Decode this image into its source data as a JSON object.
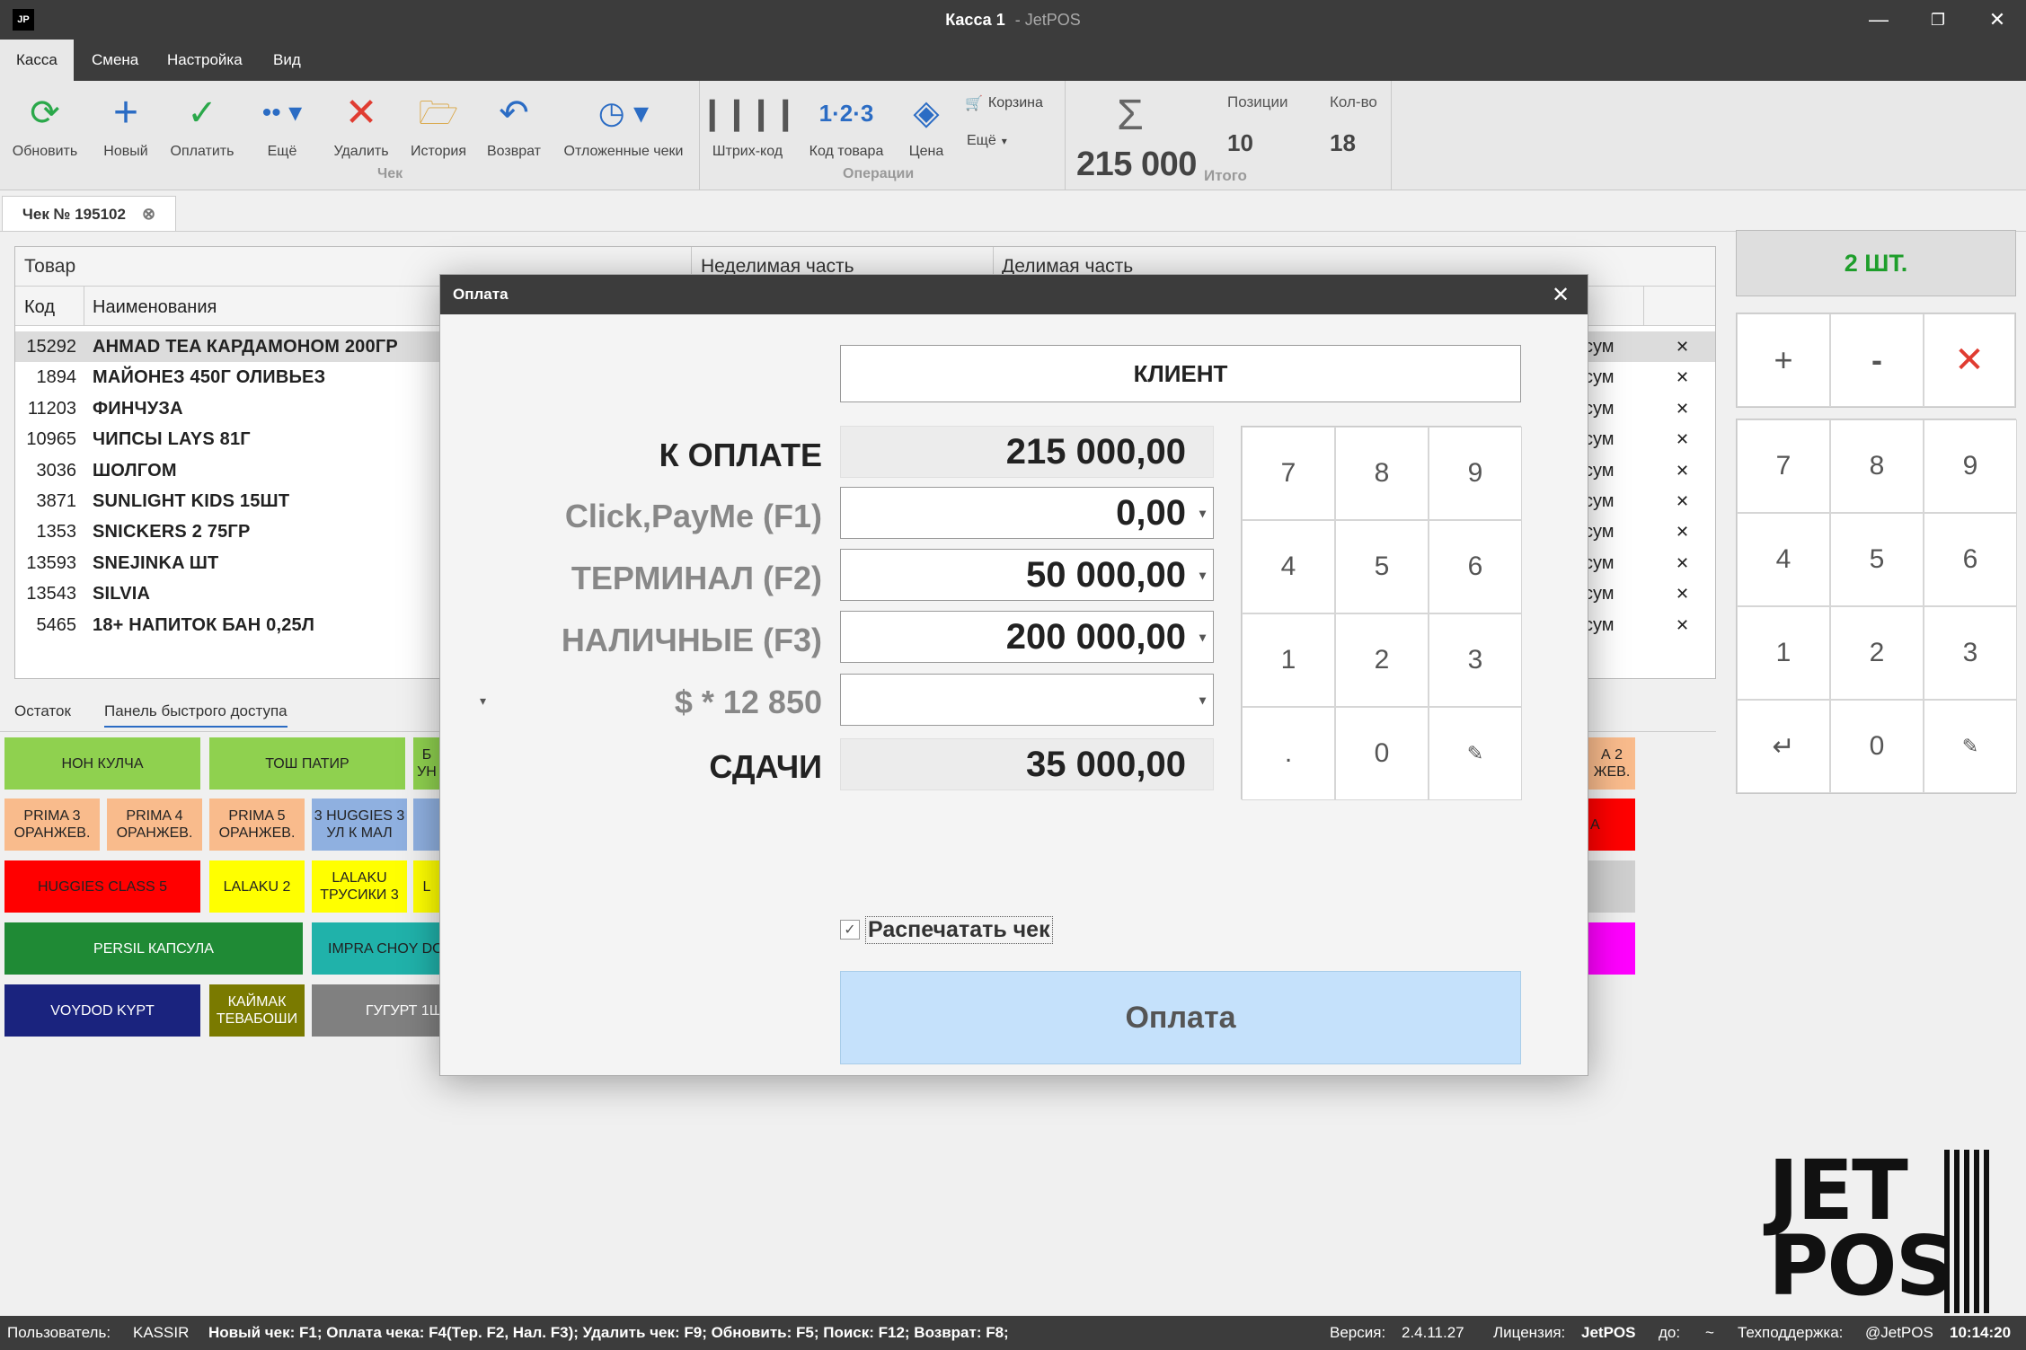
{
  "window": {
    "app_icon": "JP",
    "title_main": "Касса 1",
    "title_sep": "-",
    "title_app": "JetPOS"
  },
  "menu": [
    "Касса",
    "Смена",
    "Настройка",
    "Вид"
  ],
  "ribbon": {
    "refresh": "Обновить",
    "new": "Новый",
    "pay": "Оплатить",
    "more": "Ещё",
    "delete": "Удалить",
    "history": "История",
    "return": "Возврат",
    "deferred": "Отложенные чеки",
    "group_check": "Чек",
    "barcode": "Штрих-код",
    "code": "Код товара",
    "price": "Цена",
    "cart": "Корзина",
    "more2": "Ещё",
    "group_ops": "Операции",
    "total": "215 000",
    "total_label": "Итого",
    "positions_label": "Позиции",
    "positions": "10",
    "qty_label": "Кол-во",
    "qty": "18"
  },
  "doc_tab": "Чек № 195102",
  "grid": {
    "group_goods": "Товар",
    "group_indiv": "Неделимая часть",
    "group_div": "Делимая часть",
    "col_code": "Код",
    "col_name": "Наименования",
    "currency": "сум",
    "rows": [
      {
        "code": "15292",
        "name": "AHMAD TEA КАРДАМОНОМ 200ГР"
      },
      {
        "code": "1894",
        "name": "МАЙОНЕЗ 450Г ОЛИВЬЕЗ"
      },
      {
        "code": "11203",
        "name": "ФИНЧУЗА"
      },
      {
        "code": "10965",
        "name": "ЧИПСЫ LAYS 81Г"
      },
      {
        "code": "3036",
        "name": "ШОЛГОМ"
      },
      {
        "code": "3871",
        "name": "SUNLIGHT KIDS 15ШТ"
      },
      {
        "code": "1353",
        "name": "SNICKERS 2 75ГР"
      },
      {
        "code": "13593",
        "name": "SNEJINKA ШТ"
      },
      {
        "code": "13543",
        "name": "SILVIA"
      },
      {
        "code": "5465",
        "name": "18+ НАПИТОК БАН 0,25Л"
      }
    ]
  },
  "lower_tabs": [
    "Остаток",
    "Панель быстрого доступа"
  ],
  "tiles": {
    "t1": "НОН КУЛЧА",
    "t2": "ТОШ ПАТИР",
    "t3a": "Б",
    "t3b": "УН",
    "t4a": "PRIMA 3",
    "t4b": "ОРАНЖЕВ.",
    "t5a": "PRIMA 4",
    "t5b": "ОРАНЖЕВ.",
    "t6a": "PRIMA 5",
    "t6b": "ОРАНЖЕВ.",
    "t7a": "3 HUGGIES 3",
    "t7b": "УЛ К МАЛ",
    "t8": "HUGGIES CLASS 5",
    "t9": "LALAKU 2",
    "t10a": "LALAKU",
    "t10b": "ТРУСИКИ 3",
    "t11": "L",
    "t12": "PERSIL КАПСУЛА",
    "t13": "IMPRA CHOY DO",
    "t14": "VOYDOD KYPT",
    "t15a": "КАЙМАК",
    "t15b": "ТЕВАБОШИ",
    "t16": "ГУГУРТ 1Ш",
    "r1a": "А 2",
    "r1b": "ЖЕВ.",
    "r2": "А"
  },
  "right_panel": {
    "qty": "2 ШТ.",
    "plus": "+",
    "minus": "-",
    "keys": [
      "7",
      "8",
      "9",
      "4",
      "5",
      "6",
      "1",
      "2",
      "3",
      "",
      "0",
      ""
    ]
  },
  "dialog": {
    "title": "Оплата",
    "client": "КЛИЕНТ",
    "due_label": "К ОПЛАТЕ",
    "due": "215 000,00",
    "click_label": "Click,PayMe (F1)",
    "click": "0,00",
    "terminal_label": "ТЕРМИНАЛ (F2)",
    "terminal": "50 000,00",
    "cash_label": "НАЛИЧНЫЕ (F3)",
    "cash": "200 000,00",
    "usd_label": "$ * 12 850",
    "usd": "",
    "change_label": "СДАЧИ",
    "change": "35 000,00",
    "keys": [
      "7",
      "8",
      "9",
      "4",
      "5",
      "6",
      "1",
      "2",
      "3",
      ".",
      "0",
      ""
    ],
    "print_label": "Распечатать чек",
    "pay_button": "Оплата"
  },
  "brand": {
    "line1": "JET",
    "line2": "POS"
  },
  "status": {
    "user_label": "Пользователь:",
    "user": "KASSIR",
    "hotkeys": "Новый чек: F1; Оплата чека: F4(Тер. F2, Нал. F3); Удалить чек: F9; Обновить: F5; Поиск: F12; Возврат: F8;",
    "version_label": "Версия:",
    "version": "2.4.11.27",
    "license_label": "Лицензия:",
    "license": "JetPOS",
    "until_label": "до:",
    "until": "~",
    "support_label": "Техподдержка:",
    "support": "@JetPOS",
    "time": "10:14:20"
  },
  "colors": {
    "green": "#1e9e2b",
    "red": "#e03c31",
    "blue": "#2b6cc4",
    "pay_btn": "#c5e1fb"
  }
}
